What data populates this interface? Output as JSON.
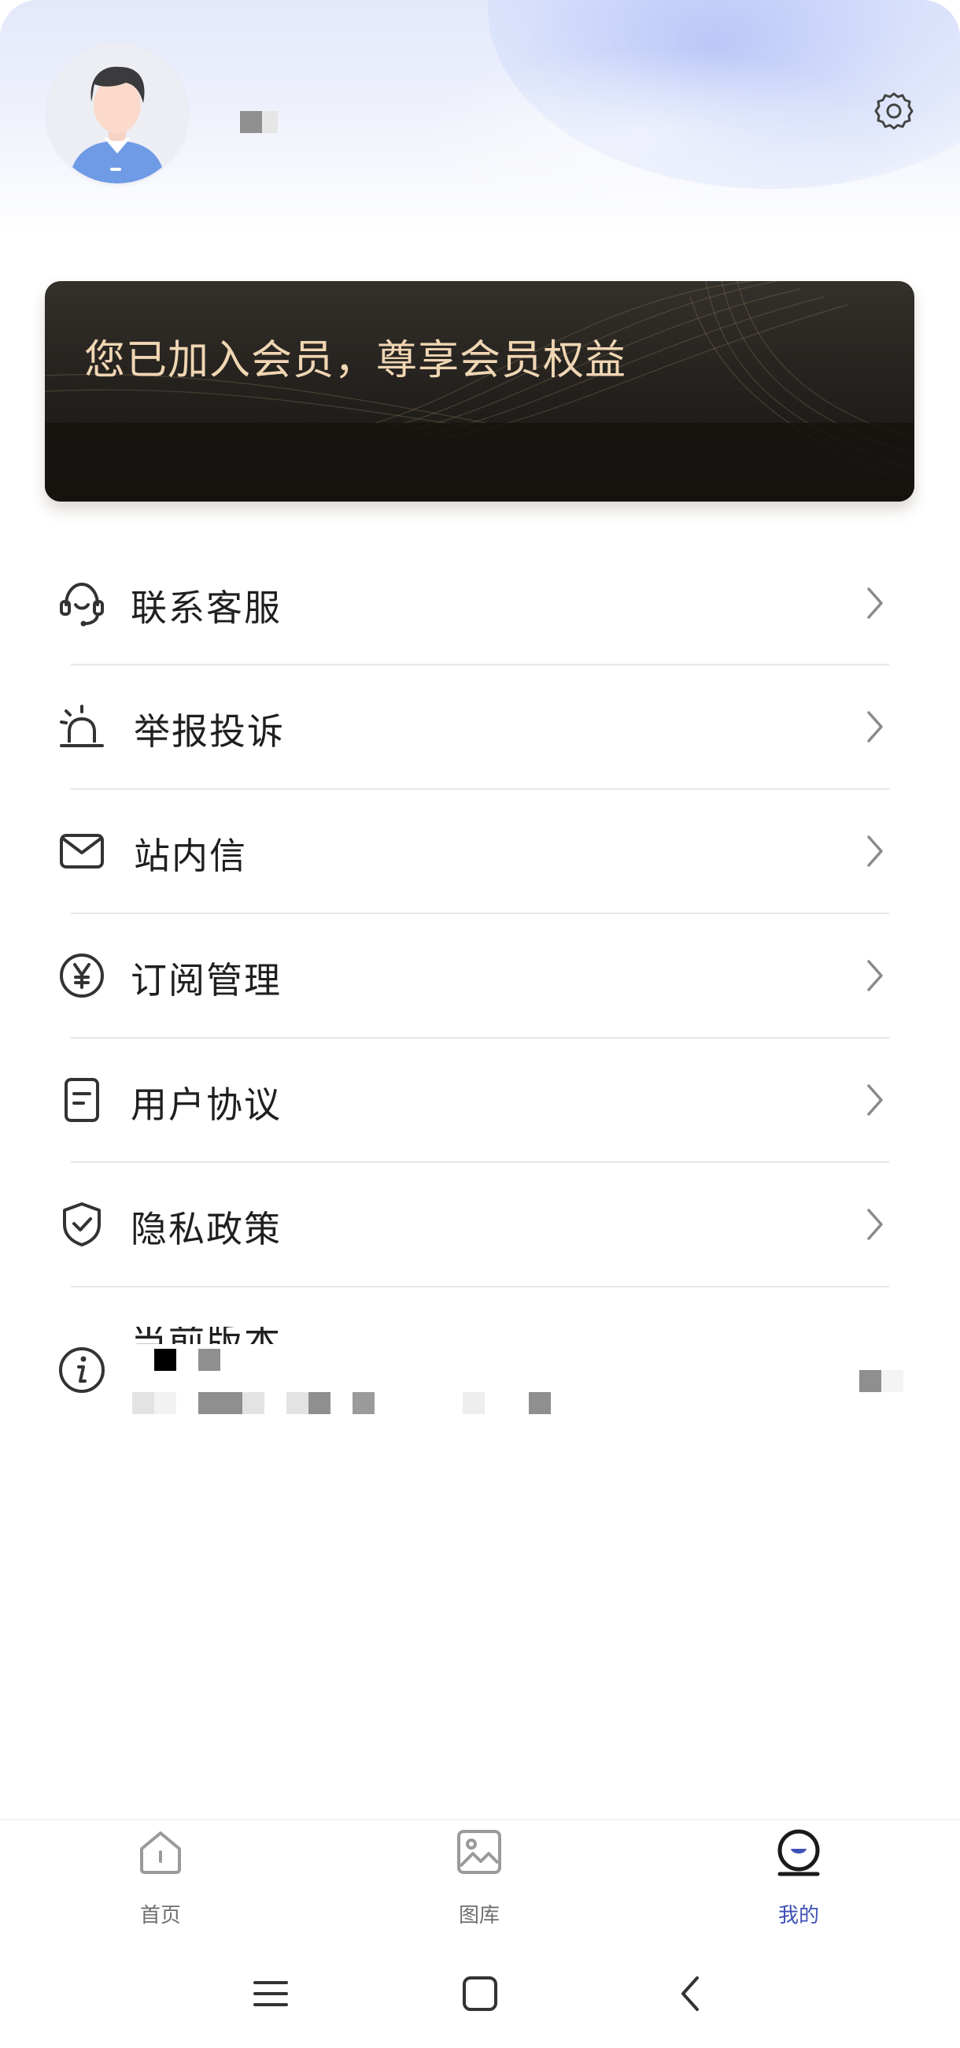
{
  "profile": {
    "avatar_icon": "default-male-avatar",
    "settings_icon": "gear-icon"
  },
  "member_card": {
    "text": "您已加入会员，尊享会员权益",
    "text_color": "#f0d6b3"
  },
  "menu": {
    "items": [
      {
        "label": "联系客服",
        "icon": "headset-icon"
      },
      {
        "label": "举报投诉",
        "icon": "alarm-icon"
      },
      {
        "label": "站内信",
        "icon": "mail-icon"
      },
      {
        "label": "订阅管理",
        "icon": "yen-icon"
      },
      {
        "label": "用户协议",
        "icon": "document-icon"
      },
      {
        "label": "隐私政策",
        "icon": "shield-check-icon"
      },
      {
        "label": "当前版本",
        "icon": "info-icon"
      }
    ]
  },
  "bottom_nav": {
    "items": [
      {
        "label": "首页",
        "icon": "home-icon"
      },
      {
        "label": "图库",
        "icon": "gallery-icon"
      },
      {
        "label": "我的",
        "icon": "profile-icon",
        "active": true
      }
    ],
    "active_color": "#3f51b5"
  },
  "system_nav": {
    "buttons": [
      "menu-icon",
      "home-square-icon",
      "back-icon"
    ]
  }
}
